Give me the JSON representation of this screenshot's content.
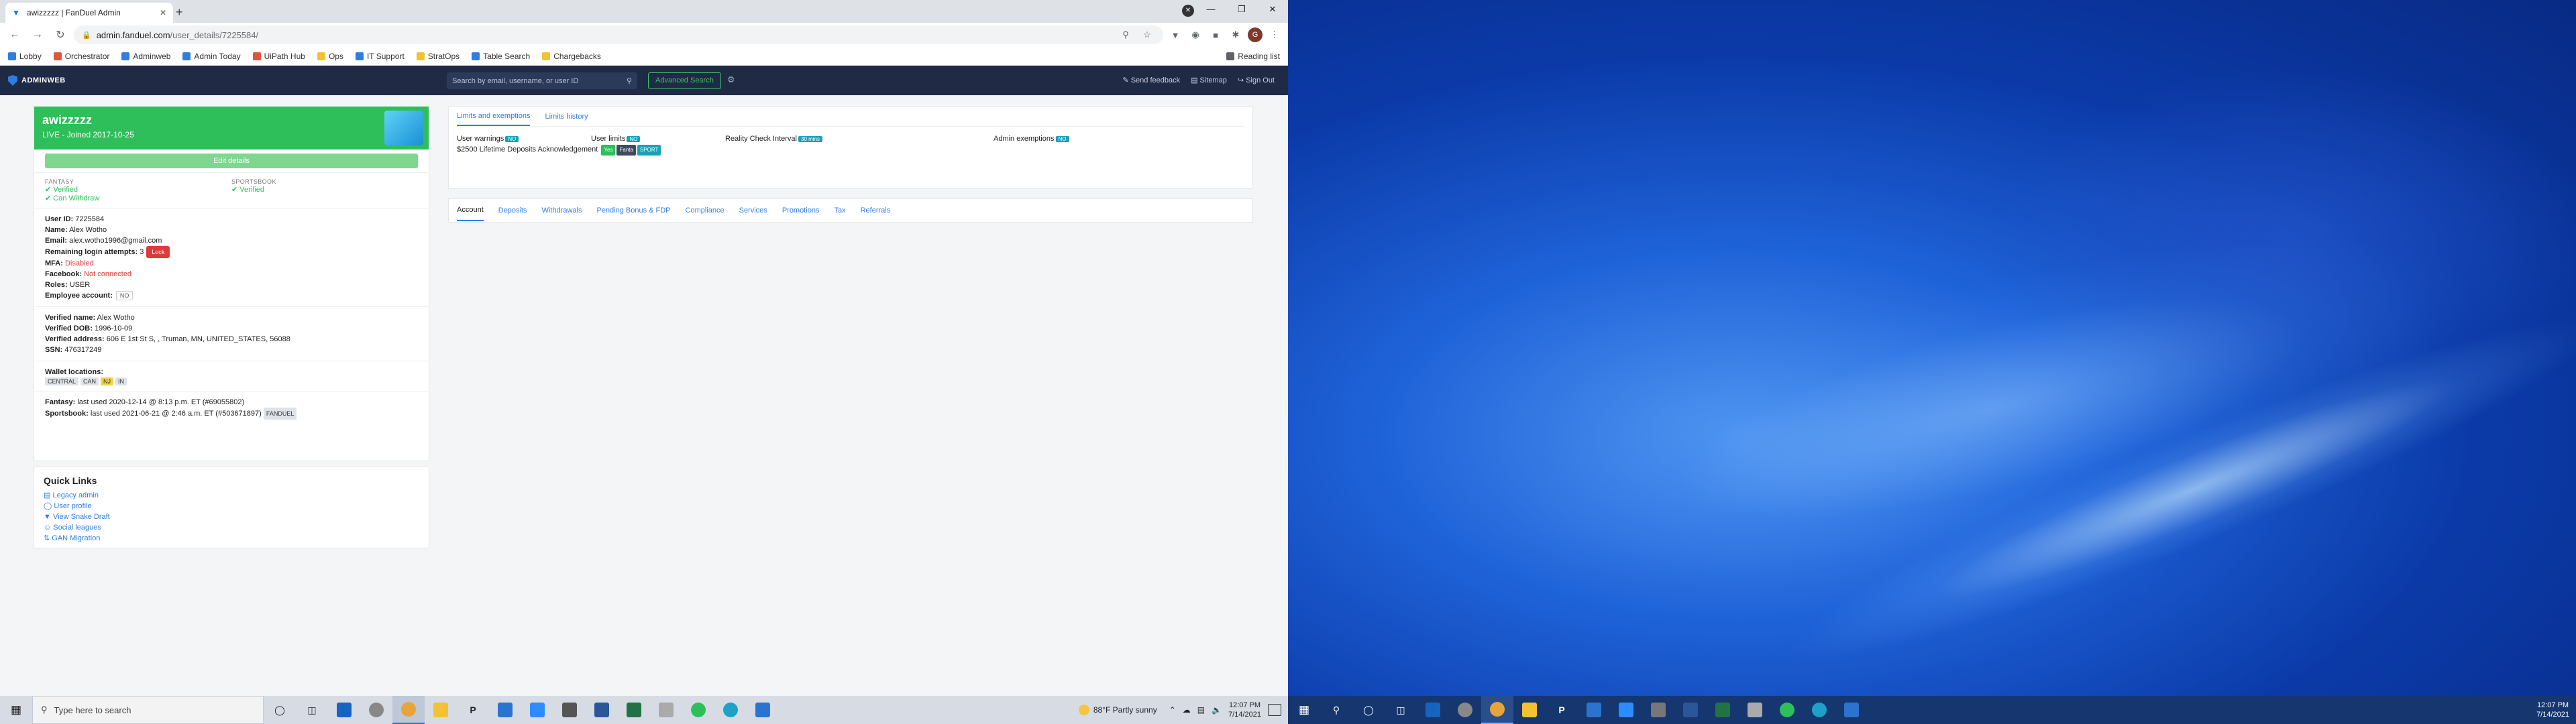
{
  "browser": {
    "tab_title": "awizzzzz | FanDuel Admin",
    "url_host": "admin.fanduel.com",
    "url_path": "/user_details/7225584/",
    "profile_initial": "S",
    "avatar_initial": "G"
  },
  "bookmarks": [
    {
      "label": "Lobby",
      "color": "#2f7de1"
    },
    {
      "label": "Orchestrator",
      "color": "#e0563b"
    },
    {
      "label": "Adminweb",
      "color": "#2f7de1"
    },
    {
      "label": "Admin Today",
      "color": "#2f7de1"
    },
    {
      "label": "UiPath Hub",
      "color": "#e0563b"
    },
    {
      "label": "Ops",
      "color": "#f2c230"
    },
    {
      "label": "IT Support",
      "color": "#2f7de1"
    },
    {
      "label": "StratOps",
      "color": "#f2c230"
    },
    {
      "label": "Table Search",
      "color": "#2f7de1"
    },
    {
      "label": "Chargebacks",
      "color": "#f2c230"
    }
  ],
  "reading_list": "Reading list",
  "appbar": {
    "brand": "ADMINWEB",
    "search_placeholder": "Search by email, username, or user ID",
    "advanced_search": "Advanced Search",
    "links": [
      "Send feedback",
      "Sitemap",
      "Sign Out"
    ]
  },
  "profile": {
    "username": "awizzzzz",
    "status": "LIVE - Joined 2017-10-25",
    "edit_label": "Edit details",
    "fantasy_label": "FANTASY",
    "fantasy_items": [
      "Verified",
      "Can Withdraw"
    ],
    "sportsbook_label": "SPORTSBOOK",
    "sportsbook_items": [
      "Verified"
    ],
    "details": [
      {
        "k": "User ID:",
        "v": "7225584"
      },
      {
        "k": "Name:",
        "v": "Alex Wotho"
      },
      {
        "k": "Email:",
        "v": "alex.wotho1996@gmail.com"
      },
      {
        "k": "Remaining login attempts:",
        "v": "3"
      },
      {
        "k": "MFA:",
        "v": "Disabled"
      },
      {
        "k": "Facebook:",
        "v": "Not connected"
      },
      {
        "k": "Roles:",
        "v": "USER"
      },
      {
        "k": "Employee account:",
        "v": "NO"
      }
    ],
    "lock_label": "Lock",
    "verified": [
      {
        "k": "Verified name:",
        "v": "Alex Wotho"
      },
      {
        "k": "Verified DOB:",
        "v": "1996-10-09"
      },
      {
        "k": "Verified address:",
        "v": "606 E 1st St S, , Truman, MN, UNITED_STATES, 56088"
      },
      {
        "k": "SSN:",
        "v": "476317249"
      }
    ],
    "wallet_label": "Wallet locations:",
    "wallet_tags": [
      "CENTRAL",
      "CAN",
      "NJ",
      "IN"
    ],
    "usage": [
      {
        "k": "Fantasy:",
        "v": "last used 2020-12-14 @ 8:13 p.m. ET (#69055802)"
      },
      {
        "k": "Sportsbook:",
        "v": "last used 2021-06-21 @ 2:46 a.m. ET (#503671897)",
        "tag": "FANDUEL"
      }
    ]
  },
  "quick_links": {
    "title": "Quick Links",
    "items": [
      "Legacy admin",
      "User profile",
      "View Snake Draft",
      "Social leagues",
      "GAN Migration"
    ]
  },
  "limits": {
    "tabs": [
      "Limits and exemptions",
      "Limits history"
    ],
    "user_warnings": "User warnings",
    "user_limits": "User limits",
    "reality_check": "Reality Check Interval",
    "admin_exemptions": "Admin exemptions",
    "deposit_ack": "$2500 Lifetime Deposits Acknowledgement",
    "badge_none": "NO",
    "badge_reality": "30 mins",
    "badge_ack": [
      "Yes",
      "Fanta",
      "SPORT"
    ]
  },
  "detail_tabs": [
    "Account",
    "Deposits",
    "Withdrawals",
    "Pending Bonus & FDP",
    "Compliance",
    "Services",
    "Promotions",
    "Tax",
    "Referrals"
  ],
  "taskbar": {
    "search_placeholder": "Type here to search",
    "weather": "88°F  Partly sunny",
    "time": "12:07 PM",
    "date": "7/14/2021"
  },
  "taskbar2": {
    "time": "12:07 PM",
    "date": "7/14/2021"
  }
}
